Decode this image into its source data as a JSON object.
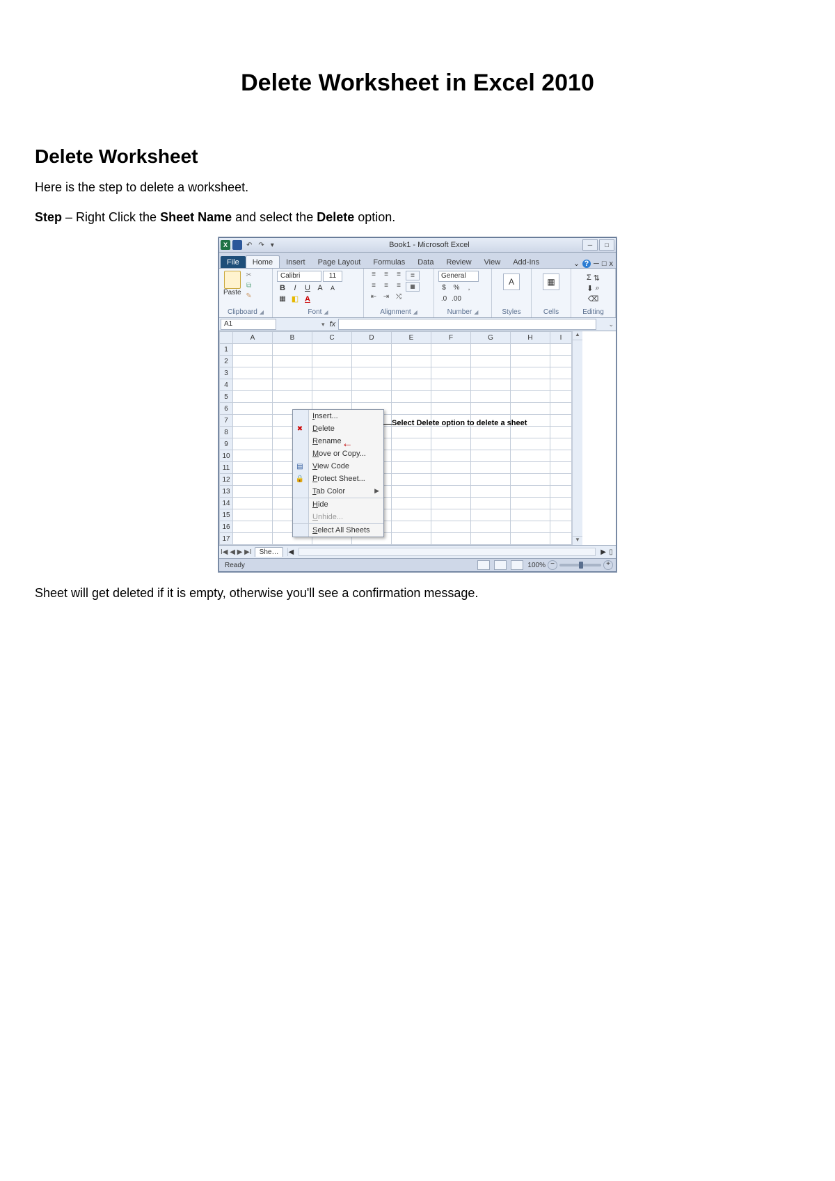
{
  "page": {
    "title": "Delete Worksheet in Excel 2010",
    "section": "Delete Worksheet",
    "intro": "Here is the step to delete a worksheet.",
    "step_prefix": "Step",
    "step_mid1": " – Right Click the ",
    "step_bold1": "Sheet Name",
    "step_mid2": " and select the ",
    "step_bold2": "Delete",
    "step_end": " option.",
    "after": "Sheet will get deleted if it is empty, otherwise you'll see a confirmation message."
  },
  "excel": {
    "title": "Book1  -  Microsoft Excel",
    "qat": {
      "undo": "↶",
      "redo": "↷",
      "more": "▾"
    },
    "win": {
      "min": "─",
      "max": "□",
      "close": ""
    },
    "tabs": [
      "File",
      "Home",
      "Insert",
      "Page Layout",
      "Formulas",
      "Data",
      "Review",
      "View",
      "Add-Ins"
    ],
    "help": {
      "caret": "⌄",
      "q": "?",
      "dash": "─",
      "restore": "□",
      "x": "x"
    },
    "ribbon": {
      "clipboard": {
        "label": "Clipboard",
        "paste": "Paste"
      },
      "font": {
        "label": "Font",
        "name": "Calibri",
        "size": "11",
        "b": "B",
        "i": "I",
        "u": "U",
        "grow": "A",
        "shrink": "A",
        "border": "▦",
        "fill": "◧",
        "color": "A"
      },
      "alignment": {
        "label": "Alignment",
        "wrap": "≣",
        "merge": "▦"
      },
      "number": {
        "label": "Number",
        "format": "General",
        "cur": "$",
        "pct": "%",
        "comma": ",",
        "inc0": ".0",
        "dec0": ".00"
      },
      "styles": {
        "label": "Styles",
        "btn": "A"
      },
      "cells": {
        "label": "Cells",
        "btn": "▦"
      },
      "editing": {
        "label": "Editing",
        "sigma": "Σ",
        "sort": "⇅",
        "find": "⌕",
        "fill": "⬇",
        "clear": "⌫"
      }
    },
    "fx": {
      "name": "A1",
      "fx": "fx"
    },
    "cols": [
      "A",
      "B",
      "C",
      "D",
      "E",
      "F",
      "G",
      "H",
      "I"
    ],
    "rows": [
      "1",
      "2",
      "3",
      "4",
      "5",
      "6",
      "7",
      "8",
      "9",
      "10",
      "11",
      "12",
      "13",
      "14",
      "15",
      "16",
      "17"
    ],
    "context": {
      "insert": "Insert...",
      "delete": "Delete",
      "rename": "Rename",
      "move": "Move or Copy...",
      "viewcode": "View Code",
      "protect": "Protect Sheet...",
      "tabcolor": "Tab Color",
      "hide": "Hide",
      "unhide": "Unhide...",
      "selectall": "Select All Sheets",
      "arrow": "←"
    },
    "callout": "Select Delete option to delete a sheet",
    "sheet": {
      "nav": "I◀ ◀ ▶ ▶I",
      "tab": "She…"
    },
    "status": {
      "ready": "Ready",
      "zoom": "100%",
      "minus": "−",
      "plus": "+"
    }
  }
}
